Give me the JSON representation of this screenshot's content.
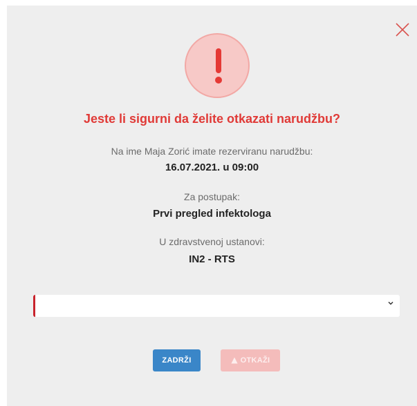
{
  "dialog": {
    "title": "Jeste li sigurni da želite otkazati narudžbu?",
    "line1": "Na ime Maja Zorić imate rezerviranu narudžbu:",
    "datetime": "16.07.2021. u 09:00",
    "procedure_label": "Za postupak:",
    "procedure": "Prvi pregled infektologa",
    "institution_label": "U zdravstvenoj ustanovi:",
    "institution": "IN2 - RTS",
    "select_value": "",
    "keep_label": "ZADRŽI",
    "cancel_label": "OTKAŽI"
  },
  "icons": {
    "close": "close-icon",
    "alert": "exclamation-icon",
    "chevron": "chevron-down-icon",
    "warning": "warning-icon"
  },
  "colors": {
    "accent_red": "#e03a37",
    "primary_blue": "#3a86c8",
    "disabled_red": "#f4bcbb"
  }
}
